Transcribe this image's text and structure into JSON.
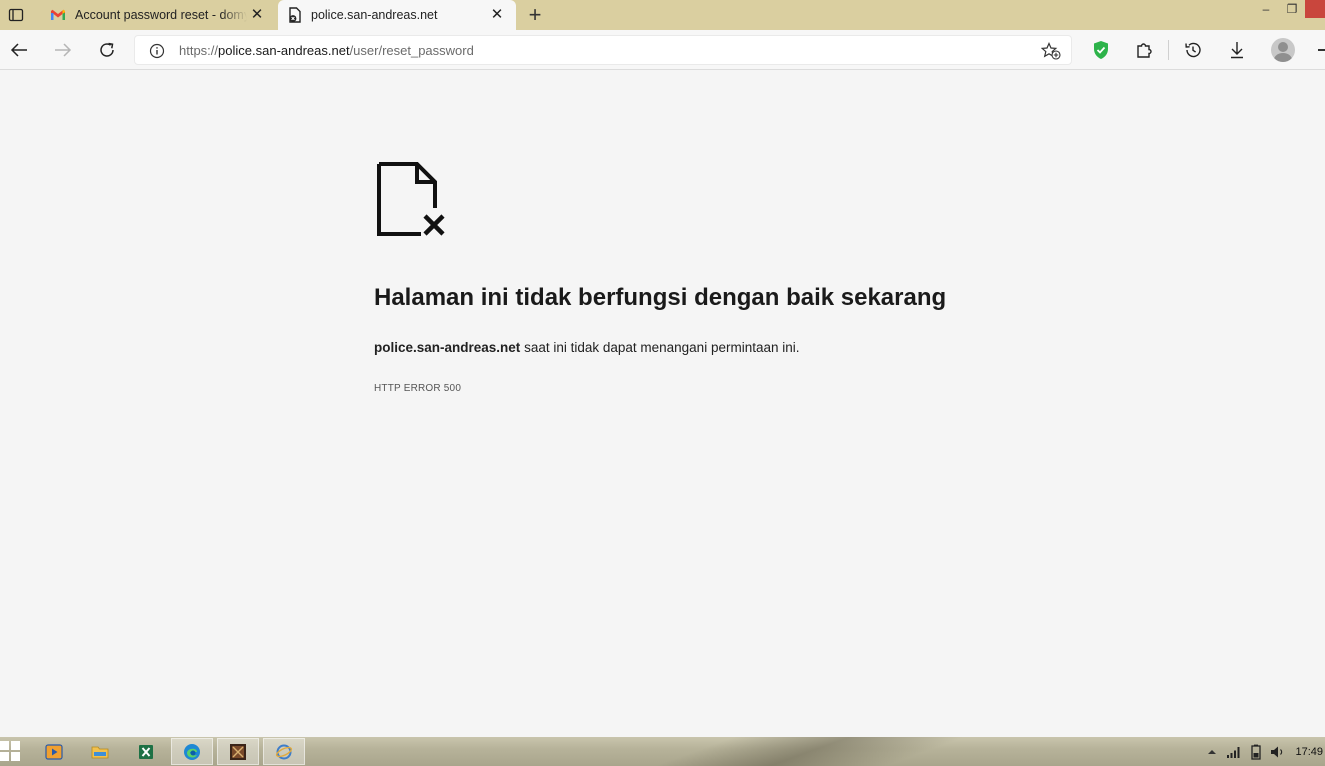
{
  "browser": {
    "tabs": [
      {
        "title": "Account password reset - domy...",
        "icon": "gmail-icon",
        "active": false
      },
      {
        "title": "police.san-andreas.net",
        "icon": "broken-page-icon",
        "active": true
      }
    ],
    "tab_close_glyph": "✕",
    "new_tab_glyph": "+",
    "window_controls": {
      "minimize": "–",
      "restore": "❐"
    },
    "address_bar": {
      "scheme": "https://",
      "host": "police.san-andreas.net",
      "path": "/user/reset_password"
    }
  },
  "error_page": {
    "title": "Halaman ini tidak berfungsi dengan baik sekarang",
    "host": "police.san-andreas.net",
    "message": " saat ini tidak dapat menangani permintaan ini.",
    "code": "HTTP ERROR 500"
  },
  "taskbar": {
    "apps": [
      "media-player-icon",
      "file-explorer-icon",
      "excel-icon",
      "edge-icon",
      "game-icon",
      "app-icon"
    ],
    "clock": "17:49"
  },
  "colors": {
    "tabbar": "#dacfa0",
    "page_bg": "#f5f5f5",
    "shield_green": "#2db34a",
    "close_red": "#c9463d"
  }
}
